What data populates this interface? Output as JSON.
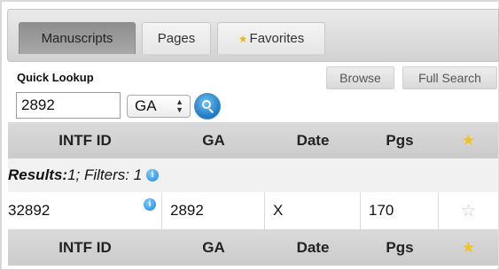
{
  "tabs": [
    {
      "label": "Manuscripts",
      "active": true
    },
    {
      "label": "Pages",
      "active": false
    },
    {
      "label": "Favorites",
      "active": false,
      "icon": "star-icon"
    }
  ],
  "quick_lookup": {
    "label": "Quick Lookup",
    "input_value": "2892",
    "select_value": "GA",
    "select_arrows": "⌃⌄"
  },
  "buttons": {
    "browse": "Browse",
    "full_search": "Full Search"
  },
  "table": {
    "columns": [
      "INTF ID",
      "GA",
      "Date",
      "Pgs"
    ],
    "results_label": "Results:",
    "results_text": " 1; Filters: 1",
    "rows": [
      {
        "intf_id": "32892",
        "ga": "2892",
        "date": "X",
        "pgs": "170"
      }
    ]
  },
  "glyphs": {
    "star_filled": "★",
    "star_empty": "☆",
    "info": "i"
  },
  "colors": {
    "accent_star": "#f4c21e",
    "info_blue": "#1e86d6"
  }
}
